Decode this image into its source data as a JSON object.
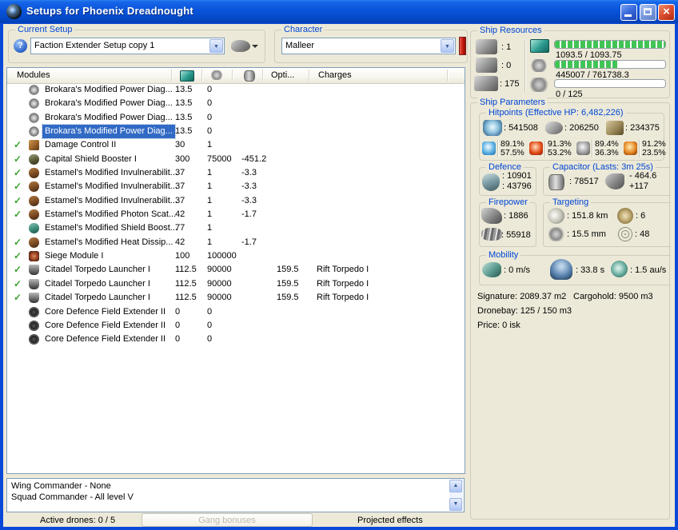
{
  "window": {
    "title": "Setups for Phoenix Dreadnought"
  },
  "colors": {
    "selection": "#316ac5",
    "bar_green": "#41c455",
    "label_blue": "#0046d5",
    "character_alert_red": "#c01408"
  },
  "toolbar": {
    "current_setup_label": "Current Setup",
    "setup_value": "Faction Extender Setup copy 1",
    "character_label": "Character",
    "character_value": "Malleer"
  },
  "modules_table": {
    "columns": {
      "modules": "Modules",
      "cpu_icon": "cpu",
      "powergrid_icon": "powergrid",
      "capacitor_icon": "capacitor",
      "opti": "Opti...",
      "charges": "Charges"
    },
    "rows": [
      {
        "check": false,
        "selected": false,
        "icon": "power-diagnostic",
        "name": "Brokara's Modified Power Diag...",
        "cpu": "13.5",
        "pg": "0",
        "cap": "",
        "opt": "",
        "charge": ""
      },
      {
        "check": false,
        "selected": false,
        "icon": "power-diagnostic",
        "name": "Brokara's Modified Power Diag...",
        "cpu": "13.5",
        "pg": "0",
        "cap": "",
        "opt": "",
        "charge": ""
      },
      {
        "check": false,
        "selected": false,
        "icon": "power-diagnostic",
        "name": "Brokara's Modified Power Diag...",
        "cpu": "13.5",
        "pg": "0",
        "cap": "",
        "opt": "",
        "charge": ""
      },
      {
        "check": false,
        "selected": true,
        "icon": "power-diagnostic",
        "name": "Brokara's Modified Power Diag...",
        "cpu": "13.5",
        "pg": "0",
        "cap": "",
        "opt": "",
        "charge": ""
      },
      {
        "check": true,
        "selected": false,
        "icon": "damage-control",
        "name": "Damage Control II",
        "cpu": "30",
        "pg": "1",
        "cap": "",
        "opt": "",
        "charge": ""
      },
      {
        "check": true,
        "selected": false,
        "icon": "shield-booster",
        "name": "Capital Shield Booster I",
        "cpu": "300",
        "pg": "75000",
        "cap": "-451.2",
        "opt": "",
        "charge": ""
      },
      {
        "check": true,
        "selected": false,
        "icon": "shield-hardener",
        "name": "Estamel's Modified Invulnerabilit...",
        "cpu": "37",
        "pg": "1",
        "cap": "-3.3",
        "opt": "",
        "charge": ""
      },
      {
        "check": true,
        "selected": false,
        "icon": "shield-hardener",
        "name": "Estamel's Modified Invulnerabilit...",
        "cpu": "37",
        "pg": "1",
        "cap": "-3.3",
        "opt": "",
        "charge": ""
      },
      {
        "check": true,
        "selected": false,
        "icon": "shield-hardener",
        "name": "Estamel's Modified Invulnerabilit...",
        "cpu": "37",
        "pg": "1",
        "cap": "-3.3",
        "opt": "",
        "charge": ""
      },
      {
        "check": true,
        "selected": false,
        "icon": "shield-hardener",
        "name": "Estamel's Modified Photon Scat...",
        "cpu": "42",
        "pg": "1",
        "cap": "-1.7",
        "opt": "",
        "charge": ""
      },
      {
        "check": false,
        "selected": false,
        "icon": "shield-amplifier",
        "name": "Estamel's Modified Shield Boost...",
        "cpu": "77",
        "pg": "1",
        "cap": "",
        "opt": "",
        "charge": ""
      },
      {
        "check": true,
        "selected": false,
        "icon": "shield-hardener",
        "name": "Estamel's Modified Heat Dissip...",
        "cpu": "42",
        "pg": "1",
        "cap": "-1.7",
        "opt": "",
        "charge": ""
      },
      {
        "check": true,
        "selected": false,
        "icon": "siege-module",
        "name": "Siege Module I",
        "cpu": "100",
        "pg": "100000",
        "cap": "",
        "opt": "",
        "charge": ""
      },
      {
        "check": true,
        "selected": false,
        "icon": "torpedo-launcher",
        "name": "Citadel Torpedo Launcher I",
        "cpu": "112.5",
        "pg": "90000",
        "cap": "",
        "opt": "159.5",
        "charge": "Rift Torpedo I"
      },
      {
        "check": true,
        "selected": false,
        "icon": "torpedo-launcher",
        "name": "Citadel Torpedo Launcher I",
        "cpu": "112.5",
        "pg": "90000",
        "cap": "",
        "opt": "159.5",
        "charge": "Rift Torpedo I"
      },
      {
        "check": true,
        "selected": false,
        "icon": "torpedo-launcher",
        "name": "Citadel Torpedo Launcher I",
        "cpu": "112.5",
        "pg": "90000",
        "cap": "",
        "opt": "159.5",
        "charge": "Rift Torpedo I"
      },
      {
        "check": false,
        "selected": false,
        "icon": "rig",
        "name": "Core Defence Field Extender II",
        "cpu": "0",
        "pg": "0",
        "cap": "",
        "opt": "",
        "charge": ""
      },
      {
        "check": false,
        "selected": false,
        "icon": "rig",
        "name": "Core Defence Field Extender II",
        "cpu": "0",
        "pg": "0",
        "cap": "",
        "opt": "",
        "charge": ""
      },
      {
        "check": false,
        "selected": false,
        "icon": "rig",
        "name": "Core Defence Field Extender II",
        "cpu": "0",
        "pg": "0",
        "cap": "",
        "opt": "",
        "charge": ""
      }
    ]
  },
  "ship_resources": {
    "label": "Ship Resources",
    "turrets": ": 1",
    "launchers": ": 0",
    "calibration": ": 175",
    "cpu_text": "1093.5 / 1093.75",
    "cpu_pct": 100,
    "pg_text": "445007 / 761738.3",
    "pg_pct": 58,
    "drone_text": "0 / 125",
    "drone_pct": 0
  },
  "ship_parameters": {
    "label": "Ship Parameters",
    "hitpoints": {
      "label": "Hitpoints (Effective HP: 6,482,226)",
      "shield": ": 541508",
      "armor": ": 206250",
      "hull": ": 234375",
      "resists": [
        {
          "name": "em",
          "top": "89.1%",
          "bottom": "57.5%"
        },
        {
          "name": "thermal",
          "top": "91.3%",
          "bottom": "53.2%"
        },
        {
          "name": "kinetic",
          "top": "89.4%",
          "bottom": "36.3%"
        },
        {
          "name": "explosive",
          "top": "91.2%",
          "bottom": "23.5%"
        }
      ]
    },
    "defence": {
      "label": "Defence",
      "line1": ": 10901",
      "line2": ": 43796"
    },
    "capacitor": {
      "label": "Capacitor (Lasts: 3m 25s)",
      "amount": ": 78517",
      "delta_top": "- 464.6",
      "delta_bottom": "+117"
    },
    "firepower": {
      "label": "Firepower",
      "line1": ": 1886",
      "line2": ": 55918"
    },
    "targeting": {
      "label": "Targeting",
      "range": ": 151.8 km",
      "sensor_strength": ": 6",
      "signature_radius": ": 15.5 mm",
      "max_targets": ": 48"
    },
    "mobility": {
      "label": "Mobility",
      "speed": ": 0 m/s",
      "align_time": ": 33.8 s",
      "warp_speed": ": 1.5 au/s"
    },
    "signature": "Signature: 2089.37 m2",
    "cargohold": "Cargohold: 9500 m3",
    "dronebay": "Dronebay: 125 / 150 m3",
    "price": "Price: 0 isk"
  },
  "bottom": {
    "lines": [
      "Wing Commander - None",
      "Squad Commander - All level V"
    ],
    "active_drones": "Active drones: 0 / 5",
    "gang_bonuses": "Gang bonuses",
    "projected_effects": "Projected effects"
  }
}
